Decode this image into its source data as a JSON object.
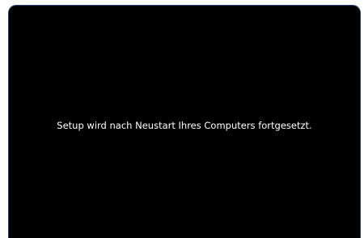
{
  "screen": {
    "message": "Setup wird nach Neustart Ihres Computers fortgesetzt."
  },
  "colors": {
    "background": "#000000",
    "text": "#ffffff",
    "frame_border": "#1f3f7a",
    "page_background": "#ffffff"
  }
}
